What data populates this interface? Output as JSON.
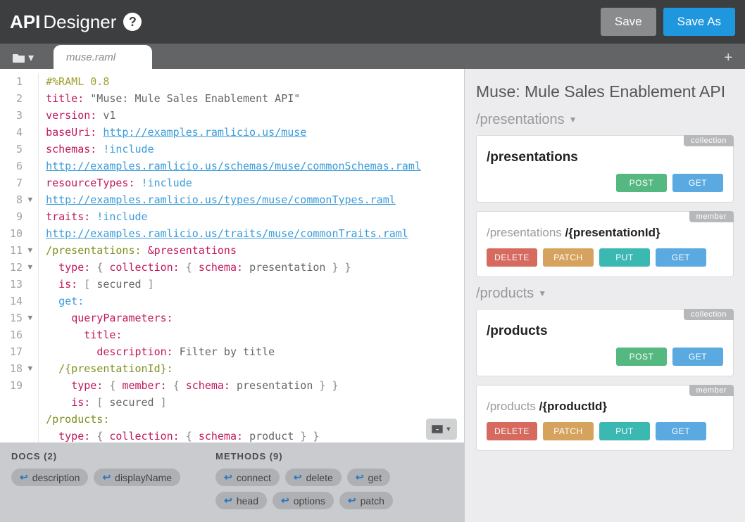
{
  "header": {
    "brand_strong": "API",
    "brand_light": "Designer",
    "help": "?",
    "save": "Save",
    "saveas": "Save As"
  },
  "tab": {
    "filename": "muse.raml"
  },
  "code": {
    "lines": [
      {
        "n": "1",
        "fold": "",
        "html": "<span class='tk-comment'>#%RAML 0.8</span>"
      },
      {
        "n": "2",
        "fold": "",
        "html": "<span class='tk-key'>title:</span> <span class='tk-str'>\"Muse: Mule Sales Enablement API\"</span>"
      },
      {
        "n": "3",
        "fold": "",
        "html": "<span class='tk-key'>version:</span> <span class='tk-str'>v1</span>"
      },
      {
        "n": "4",
        "fold": "",
        "html": "<span class='tk-key'>baseUri:</span> <span class='tk-url'>http://examples.ramlicio.us/muse</span>"
      },
      {
        "n": "5",
        "fold": "",
        "html": "<span class='tk-key'>schemas:</span> <span class='tk-tag'>!include</span>"
      },
      {
        "n": "",
        "fold": "",
        "html": "<span class='tk-url'>http://examples.ramlicio.us/schemas/muse/commonSchemas.raml</span>"
      },
      {
        "n": "6",
        "fold": "",
        "html": "<span class='tk-key'>resourceTypes:</span> <span class='tk-tag'>!include</span>"
      },
      {
        "n": "",
        "fold": "",
        "html": "<span class='tk-url'>http://examples.ramlicio.us/types/muse/commonTypes.raml</span>"
      },
      {
        "n": "7",
        "fold": "",
        "html": "<span class='tk-key'>traits:</span> <span class='tk-tag'>!include</span>"
      },
      {
        "n": "",
        "fold": "",
        "html": "<span class='tk-url'>http://examples.ramlicio.us/traits/muse/commonTraits.raml</span>"
      },
      {
        "n": "8",
        "fold": "▼",
        "html": "<span class='tk-route'>/presentations:</span> <span class='tk-anchor'>&amp;presentations</span>"
      },
      {
        "n": "9",
        "fold": "",
        "html": "  <span class='tk-key'>type:</span> <span class='tk-punc'>{</span> <span class='tk-key'>collection:</span> <span class='tk-punc'>{</span> <span class='tk-key'>schema:</span> <span class='tk-str'>presentation</span> <span class='tk-punc'>} }</span>"
      },
      {
        "n": "10",
        "fold": "",
        "html": "  <span class='tk-key'>is:</span> <span class='tk-punc'>[</span> <span class='tk-str'>secured</span> <span class='tk-punc'>]</span>"
      },
      {
        "n": "11",
        "fold": "▼",
        "html": "  <span class='tk-method'>get:</span>"
      },
      {
        "n": "12",
        "fold": "▼",
        "html": "    <span class='tk-key'>queryParameters:</span>"
      },
      {
        "n": "13",
        "fold": "",
        "html": "      <span class='tk-key'>title:</span>"
      },
      {
        "n": "14",
        "fold": "",
        "html": "        <span class='tk-key'>description:</span> <span class='tk-str'>Filter by title</span>"
      },
      {
        "n": "15",
        "fold": "▼",
        "html": "  <span class='tk-route'>/{presentationId}:</span>"
      },
      {
        "n": "16",
        "fold": "",
        "html": "    <span class='tk-key'>type:</span> <span class='tk-punc'>{</span> <span class='tk-key'>member:</span> <span class='tk-punc'>{</span> <span class='tk-key'>schema:</span> <span class='tk-str'>presentation</span> <span class='tk-punc'>} }</span>"
      },
      {
        "n": "17",
        "fold": "",
        "html": "    <span class='tk-key'>is:</span> <span class='tk-punc'>[</span> <span class='tk-str'>secured</span> <span class='tk-punc'>]</span>"
      },
      {
        "n": "18",
        "fold": "▼",
        "html": "<span class='tk-route'>/products:</span>"
      },
      {
        "n": "19",
        "fold": "",
        "html": "  <span class='tk-key'>type:</span> <span class='tk-punc'>{</span> <span class='tk-key'>collection:</span> <span class='tk-punc'>{</span> <span class='tk-key'>schema:</span> <span class='tk-str'>product</span> <span class='tk-punc'>} }</span>"
      }
    ]
  },
  "shelf": {
    "docs_label": "DOCS (2)",
    "methods_label": "METHODS (9)",
    "docs": [
      "description",
      "displayName"
    ],
    "methods": [
      "connect",
      "delete",
      "get",
      "head",
      "options",
      "patch"
    ]
  },
  "preview": {
    "title": "Muse: Mule Sales Enablement API",
    "sections": [
      {
        "label": "/presentations",
        "cards": [
          {
            "badge": "collection",
            "prefix": "",
            "bold": "/presentations",
            "methods": [
              {
                "t": "POST",
                "c": "m-post"
              },
              {
                "t": "GET",
                "c": "m-get"
              }
            ],
            "align": "right",
            "big": true
          },
          {
            "badge": "member",
            "prefix": "/presentations ",
            "bold": "/{presentationId}",
            "methods": [
              {
                "t": "DELETE",
                "c": "m-delete"
              },
              {
                "t": "PATCH",
                "c": "m-patch"
              },
              {
                "t": "PUT",
                "c": "m-put"
              },
              {
                "t": "GET",
                "c": "m-get"
              }
            ],
            "align": "left"
          }
        ]
      },
      {
        "label": "/products",
        "cards": [
          {
            "badge": "collection",
            "prefix": "",
            "bold": "/products",
            "methods": [
              {
                "t": "POST",
                "c": "m-post"
              },
              {
                "t": "GET",
                "c": "m-get"
              }
            ],
            "align": "right",
            "big": true
          },
          {
            "badge": "member",
            "prefix": "/products ",
            "bold": "/{productId}",
            "methods": [
              {
                "t": "DELETE",
                "c": "m-delete"
              },
              {
                "t": "PATCH",
                "c": "m-patch"
              },
              {
                "t": "PUT",
                "c": "m-put"
              },
              {
                "t": "GET",
                "c": "m-get"
              }
            ],
            "align": "left"
          }
        ]
      }
    ]
  }
}
